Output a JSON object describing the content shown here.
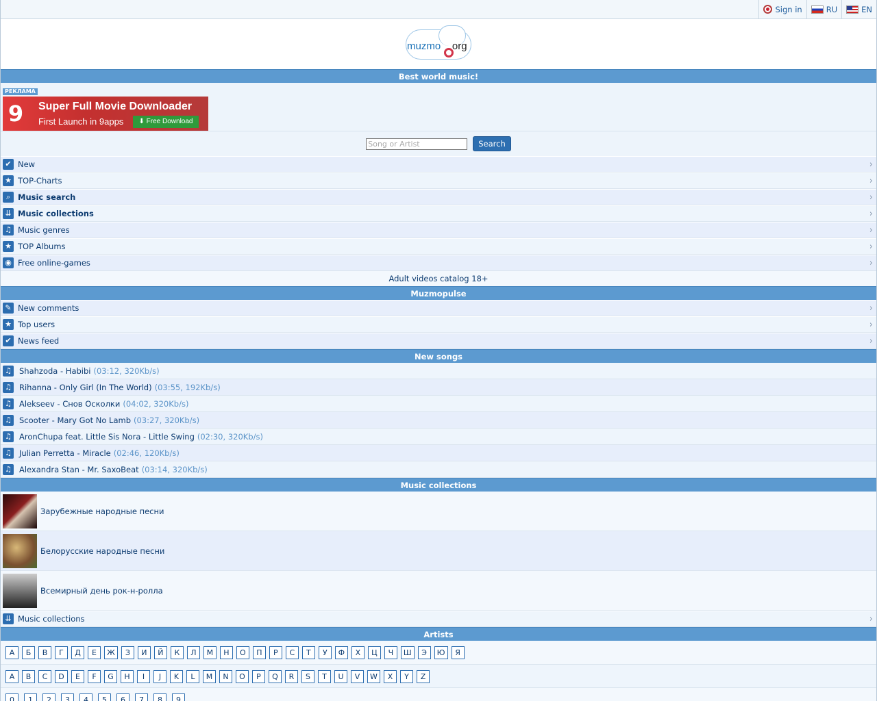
{
  "topbar": {
    "signin": "Sign in",
    "lang_ru": "RU",
    "lang_en": "EN"
  },
  "logo": {
    "part1": "muzmo",
    "part2": "org"
  },
  "banner_title": "Best world music!",
  "ad": {
    "tag": "РЕКЛАМА",
    "number": "9",
    "line1": "Super Full Movie Downloader",
    "line2": "First Launch in 9apps",
    "button": "Free Download"
  },
  "search": {
    "placeholder": "Song or Artist",
    "button": "Search"
  },
  "menu": [
    {
      "label": "New",
      "icon": "check-icon",
      "bold": false
    },
    {
      "label": "TOP-Charts",
      "icon": "star-icon",
      "bold": false
    },
    {
      "label": "Music search",
      "icon": "search-icon",
      "bold": true
    },
    {
      "label": "Music collections",
      "icon": "double-chevron-down-icon",
      "bold": true
    },
    {
      "label": "Music genres",
      "icon": "music-note-icon",
      "bold": false
    },
    {
      "label": "TOP Albums",
      "icon": "star-icon",
      "bold": false
    },
    {
      "label": "Free online-games",
      "icon": "gamepad-icon",
      "bold": false
    }
  ],
  "adult_link": "Adult videos catalog 18+",
  "muzmopulse": {
    "title": "Muzmopulse",
    "items": [
      {
        "label": "New comments",
        "icon": "pen-icon"
      },
      {
        "label": "Top users",
        "icon": "star-icon"
      },
      {
        "label": "News feed",
        "icon": "check-icon"
      }
    ]
  },
  "new_songs": {
    "title": "New songs",
    "items": [
      {
        "title": "Shahzoda - Habibi",
        "meta": "(03:12, 320Kb/s)"
      },
      {
        "title": "Rihanna - Only Girl (In The World)",
        "meta": "(03:55, 192Kb/s)"
      },
      {
        "title": "Alekseev - Снов Осколки",
        "meta": "(04:02, 320Kb/s)"
      },
      {
        "title": "Scooter - Mary Got No Lamb",
        "meta": "(03:27, 320Kb/s)"
      },
      {
        "title": "AronChupa feat. Little Sis Nora - Little Swing",
        "meta": "(02:30, 320Kb/s)"
      },
      {
        "title": "Julian Perretta - Miracle",
        "meta": "(02:46, 120Kb/s)"
      },
      {
        "title": "Alexandra Stan - Mr. SaxoBeat",
        "meta": "(03:14, 320Kb/s)"
      }
    ]
  },
  "collections": {
    "title": "Music collections",
    "items": [
      {
        "label": "Зарубежные народные песни"
      },
      {
        "label": "Белорусские народные песни"
      },
      {
        "label": "Всемирный день рок-н-ролла"
      }
    ],
    "more": "Music collections"
  },
  "artists": {
    "title": "Artists",
    "cyrillic": [
      "А",
      "Б",
      "В",
      "Г",
      "Д",
      "Е",
      "Ж",
      "З",
      "И",
      "Й",
      "К",
      "Л",
      "М",
      "Н",
      "О",
      "П",
      "Р",
      "С",
      "Т",
      "У",
      "Ф",
      "Х",
      "Ц",
      "Ч",
      "Ш",
      "Э",
      "Ю",
      "Я"
    ],
    "latin": [
      "A",
      "B",
      "C",
      "D",
      "E",
      "F",
      "G",
      "H",
      "I",
      "J",
      "K",
      "L",
      "M",
      "N",
      "O",
      "P",
      "Q",
      "R",
      "S",
      "T",
      "U",
      "V",
      "W",
      "X",
      "Y",
      "Z"
    ],
    "digits": [
      "0",
      "1",
      "2",
      "3",
      "4",
      "5",
      "6",
      "7",
      "8",
      "9"
    ]
  }
}
